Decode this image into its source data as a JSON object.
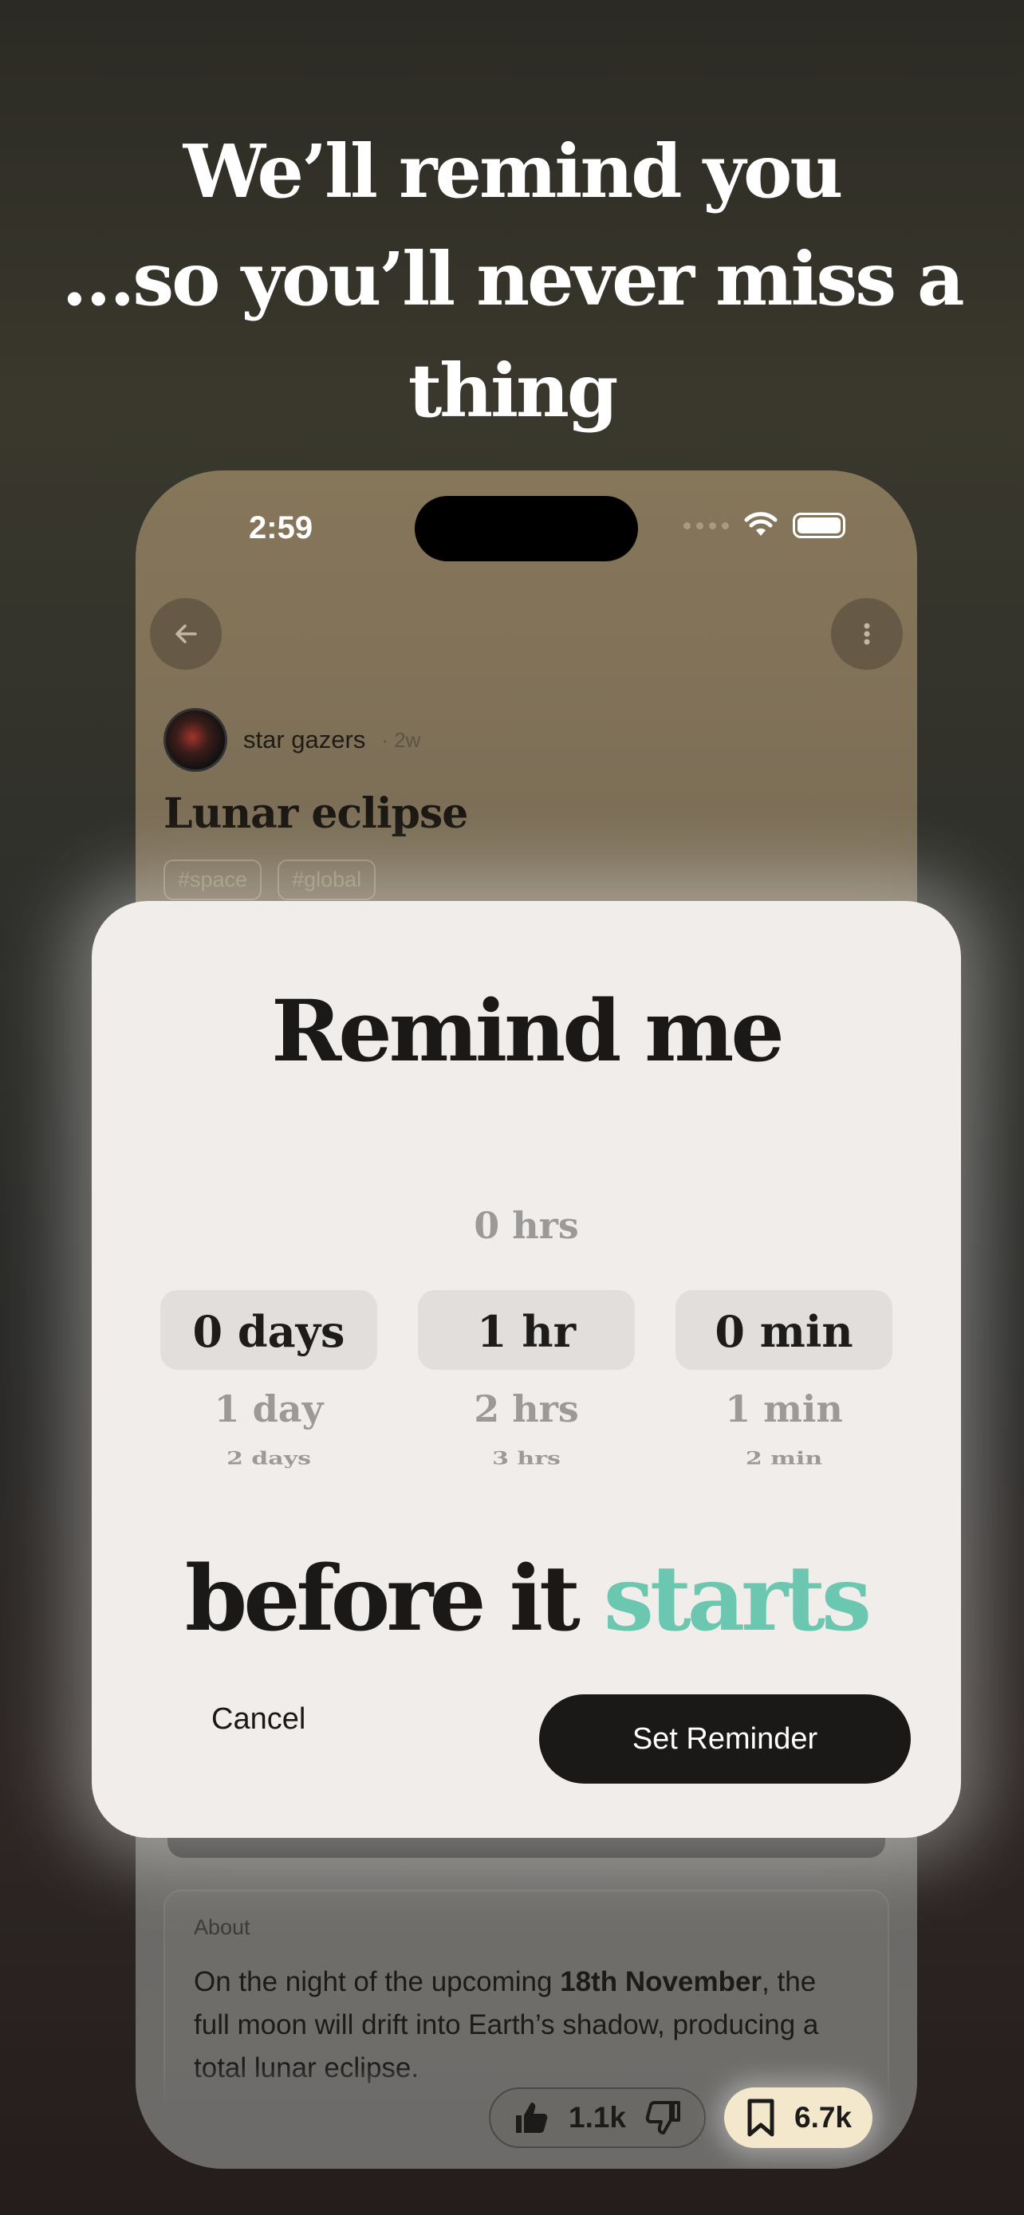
{
  "headline": {
    "line1": "We’ll remind you",
    "line2": "…so you’ll never miss a thing"
  },
  "phone": {
    "status_time": "2:59",
    "author": "star gazers",
    "post_age": "· 2w",
    "post_title": "Lunar eclipse",
    "tags": [
      "#space",
      "#global"
    ],
    "about": {
      "label": "About",
      "text_before": "On the night of the upcoming ",
      "text_bold": "18th November",
      "text_after": ", the full moon will drift into Earth’s shadow, producing a total lunar eclipse."
    },
    "votes": {
      "count": "1.1k"
    },
    "saves": {
      "count": "6.7k"
    }
  },
  "modal": {
    "title": "Remind me",
    "picker": {
      "days": {
        "selected": "0 days",
        "below": [
          "1 day",
          "2 days"
        ]
      },
      "hours": {
        "above": "0 hrs",
        "selected": "1 hr",
        "below": [
          "2 hrs",
          "3 hrs"
        ]
      },
      "minutes": {
        "selected": "0 min",
        "below": [
          "1 min",
          "2 min"
        ]
      }
    },
    "before_text": "before it",
    "before_accent": "starts",
    "cancel_label": "Cancel",
    "set_label": "Set Reminder"
  },
  "colors": {
    "accent": "#6cc7b0",
    "primary_button": "#1a1918",
    "modal_bg": "#f0edea"
  },
  "icons": [
    "back-arrow-icon",
    "more-vertical-icon",
    "wifi-icon",
    "battery-icon",
    "thumbs-up-icon",
    "thumbs-down-icon",
    "bookmark-icon"
  ]
}
